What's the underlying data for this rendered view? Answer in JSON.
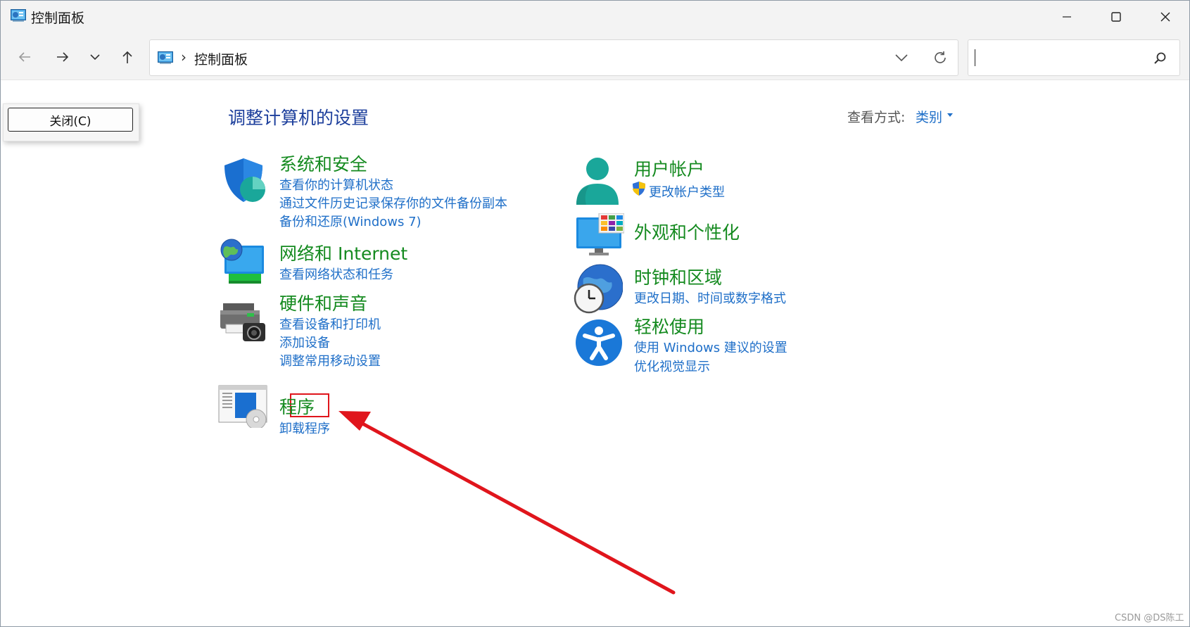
{
  "window": {
    "title": "控制面板",
    "app_icon": "control-panel-icon"
  },
  "titlebar_buttons": {
    "minimize": "minimize-icon",
    "maximize": "maximize-icon",
    "close": "close-icon"
  },
  "nav": {
    "back": "back-arrow-icon",
    "forward": "forward-arrow-icon",
    "recent": "chevron-down-icon",
    "up": "up-arrow-icon"
  },
  "address": {
    "separator": "›",
    "path": "控制面板"
  },
  "search": {
    "placeholder": "",
    "value": ""
  },
  "popup": {
    "close_label": "关闭(C)"
  },
  "main": {
    "heading": "调整计算机的设置",
    "view_by_label": "查看方式:",
    "view_by_value": "类别"
  },
  "categories": [
    {
      "title": "系统和安全",
      "icon": "security-shield-icon",
      "links": [
        "查看你的计算机状态",
        "通过文件历史记录保存你的文件备份副本",
        "备份和还原(Windows 7)"
      ]
    },
    {
      "title": "网络和 Internet",
      "icon": "network-globe-icon",
      "links": [
        "查看网络状态和任务"
      ]
    },
    {
      "title": "硬件和声音",
      "icon": "printer-camera-icon",
      "links": [
        "查看设备和打印机",
        "添加设备",
        "调整常用移动设置"
      ]
    },
    {
      "title": "程序",
      "icon": "programs-icon",
      "links": [
        "卸载程序"
      ]
    },
    {
      "title": "用户帐户",
      "icon": "user-account-icon",
      "links": [
        "更改帐户类型"
      ]
    },
    {
      "title": "外观和个性化",
      "icon": "personalization-monitor-icon",
      "links": []
    },
    {
      "title": "时钟和区域",
      "icon": "clock-globe-icon",
      "links": [
        "更改日期、时间或数字格式"
      ]
    },
    {
      "title": "轻松使用",
      "icon": "accessibility-icon",
      "links": [
        "使用 Windows 建议的设置",
        "优化视觉显示"
      ]
    }
  ],
  "annotation": {
    "color": "#e0151c"
  },
  "colors": {
    "category_title": "#148a1f",
    "link": "#1f6fc8",
    "heading": "#1d3f9c"
  },
  "watermark": "CSDN @DS陈工"
}
